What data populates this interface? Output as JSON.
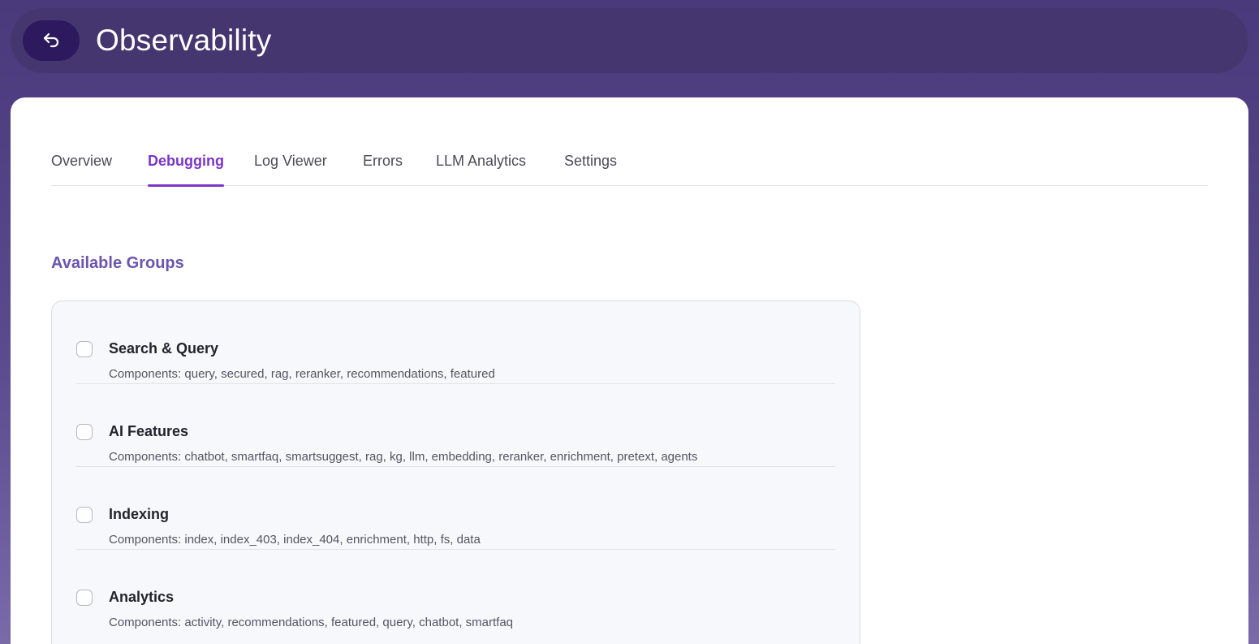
{
  "header": {
    "title": "Observability",
    "back_icon": "back-arrow-icon"
  },
  "tabs": [
    {
      "label": "Overview",
      "active": false
    },
    {
      "label": "Debugging",
      "active": true
    },
    {
      "label": "Log Viewer",
      "active": false
    },
    {
      "label": "Errors",
      "active": false
    },
    {
      "label": "LLM Analytics",
      "active": false
    },
    {
      "label": "Settings",
      "active": false
    }
  ],
  "section": {
    "title": "Available Groups"
  },
  "groups": [
    {
      "name": "Search & Query",
      "components": "Components: query, secured, rag, reranker, recommendations, featured",
      "checked": false
    },
    {
      "name": "AI Features",
      "components": "Components: chatbot, smartfaq, smartsuggest, rag, kg, llm, embedding, reranker, enrichment, pretext, agents",
      "checked": false
    },
    {
      "name": "Indexing",
      "components": "Components: index, index_403, index_404, enrichment, http, fs, data",
      "checked": false
    },
    {
      "name": "Analytics",
      "components": "Components: activity, recommendations, featured, query, chatbot, smartfaq",
      "checked": false
    }
  ],
  "colors": {
    "accent": "#7a35c9",
    "section_title": "#6a55b0",
    "header_bg": "#463670",
    "back_button_bg": "#2d1a5e"
  }
}
